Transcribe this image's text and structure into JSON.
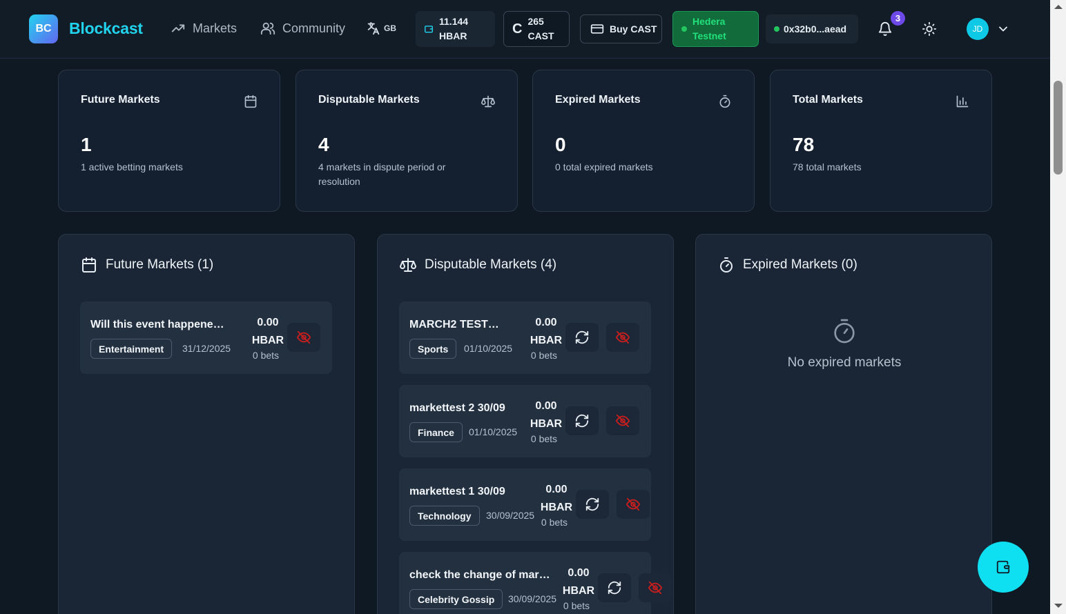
{
  "header": {
    "logo_initials": "BC",
    "brand": "Blockcast",
    "nav": {
      "markets": "Markets",
      "community": "Community"
    },
    "language": "GB",
    "hbar_balance": {
      "amount": "11.144",
      "unit": "HBAR"
    },
    "cast_balance": {
      "symbol": "C",
      "amount": "265",
      "unit": "CAST"
    },
    "buy_label": "Buy CAST",
    "network": {
      "line1": "Hedera",
      "line2": "Testnet"
    },
    "wallet_address": "0x32b0...aead",
    "notification_count": "3",
    "user_initials": "JD"
  },
  "stats": [
    {
      "title": "Future Markets",
      "value": "1",
      "sub": "1 active betting markets",
      "icon": "calendar-icon"
    },
    {
      "title": "Disputable Markets",
      "value": "4",
      "sub": "4 markets in dispute period or resolution",
      "icon": "scale-icon"
    },
    {
      "title": "Expired Markets",
      "value": "0",
      "sub": "0 total expired markets",
      "icon": "timer-icon"
    },
    {
      "title": "Total Markets",
      "value": "78",
      "sub": "78 total markets",
      "icon": "bar-chart-icon"
    }
  ],
  "panels": {
    "future": {
      "title": "Future Markets (1)",
      "items": [
        {
          "title": "Will this event happene…",
          "tag": "Entertainment",
          "date": "31/12/2025",
          "amount": "0.00",
          "unit": "HBAR",
          "bets": "0 bets"
        }
      ]
    },
    "disputable": {
      "title": "Disputable Markets (4)",
      "items": [
        {
          "title": "MARCH2 TEST…",
          "tag": "Sports",
          "date": "01/10/2025",
          "amount": "0.00",
          "unit": "HBAR",
          "bets": "0 bets"
        },
        {
          "title": "markettest 2 30/09",
          "tag": "Finance",
          "date": "01/10/2025",
          "amount": "0.00",
          "unit": "HBAR",
          "bets": "0 bets"
        },
        {
          "title": "markettest 1 30/09",
          "tag": "Technology",
          "date": "30/09/2025",
          "amount": "0.00",
          "unit": "HBAR",
          "bets": "0 bets"
        },
        {
          "title": "check the change of mar…",
          "tag": "Celebrity Gossip",
          "date": "30/09/2025",
          "amount": "0.00",
          "unit": "HBAR",
          "bets": "0 bets"
        }
      ]
    },
    "expired": {
      "title": "Expired Markets (0)",
      "empty_text": "No expired markets"
    }
  },
  "colors": {
    "accent": "#22d3ee",
    "background": "#0f1923",
    "card": "#142030",
    "danger": "#c81e1e",
    "network_green": "#116b3a"
  }
}
